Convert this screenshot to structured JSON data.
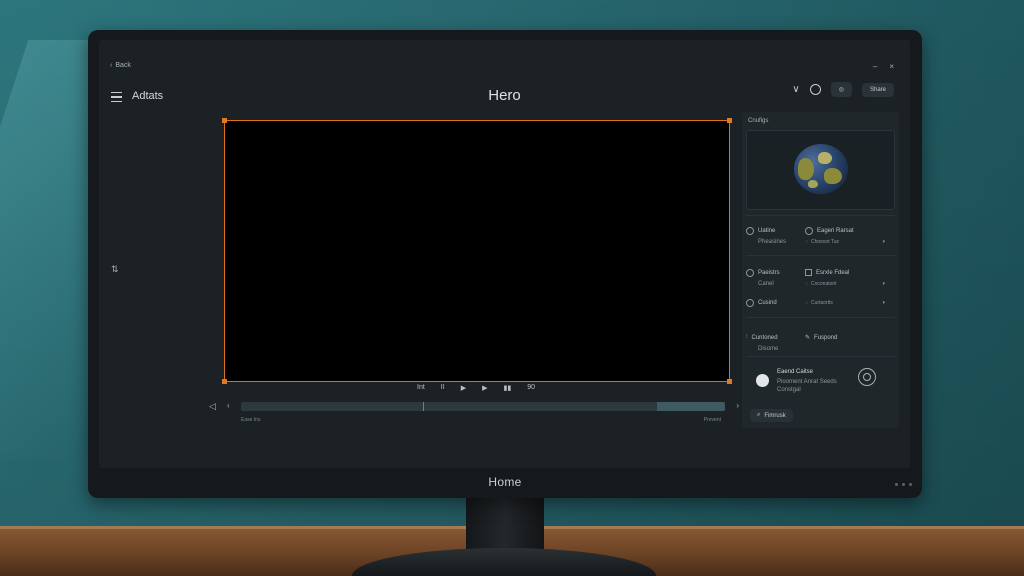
{
  "window": {
    "back_label": "Back",
    "app_name": "Adtats",
    "page_title": "Hero",
    "min_glyph": "–",
    "close_glyph": "×",
    "share_label": "Share",
    "chin_label": "Home"
  },
  "player": {
    "control_labels": [
      "Int",
      "II",
      "▶",
      "▶",
      "▮▮",
      "90"
    ],
    "timeline": {
      "start_label": "Ease Ins",
      "end_label": "Prevent",
      "progress": 0.86
    }
  },
  "panel": {
    "title": "Cnufigs",
    "rows": [
      {
        "label": "Uatine",
        "sub": "Pheasines",
        "right_title": "Eageri Rarsat",
        "right_value": "Chosoot Tux"
      },
      {
        "label": "Paeistrs",
        "sub": "Canel",
        "right_title": "Esrxle Fdeal",
        "right_value": "Coconatont"
      },
      {
        "label": "Cusind",
        "sub": "",
        "right_title": "",
        "right_value": "Curtaortts"
      },
      {
        "label": "Cuntoned",
        "sub": "Disome",
        "right_title": "Fuspond",
        "right_value": ""
      }
    ],
    "profile": {
      "name": "Eaend Caitse",
      "line1": "Piooment Anrat Seeds",
      "line2": "Constgal"
    },
    "search_label": "Fimrusk"
  }
}
